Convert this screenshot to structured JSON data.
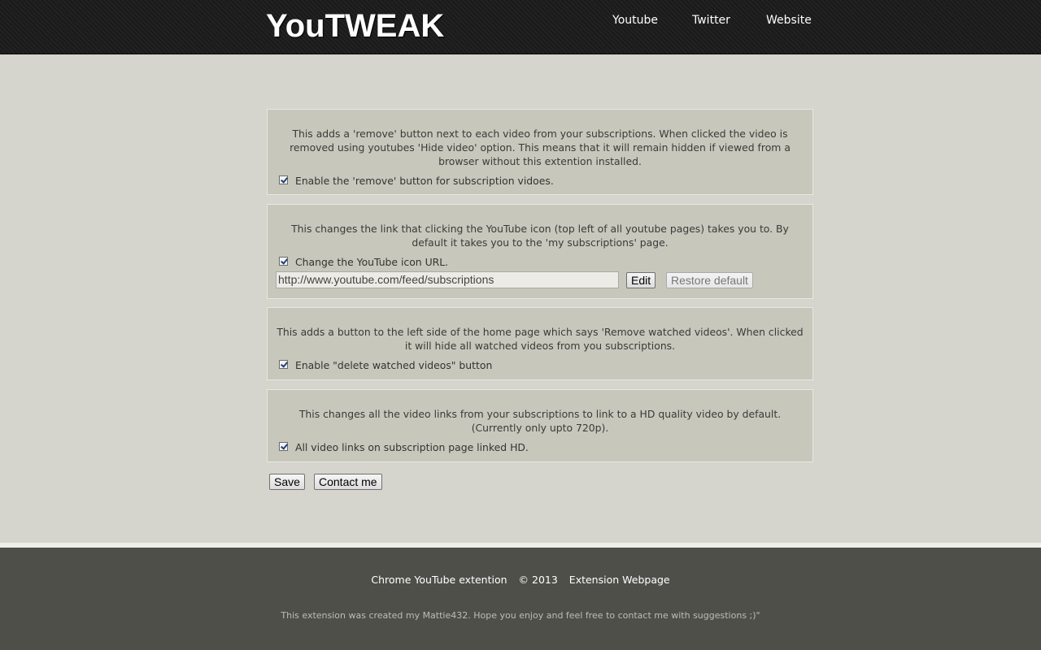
{
  "header": {
    "logo": "YouTWEAK",
    "nav": [
      "Youtube",
      "Twitter",
      "Website"
    ]
  },
  "panels": [
    {
      "description": "This adds a 'remove' button next to each video from your subscriptions. When clicked the video is removed using youtubes 'Hide video' option. This means that it will remain hidden if viewed from a browser without this extention installed.",
      "option_label": "Enable the 'remove' button for subscription vidoes.",
      "checked": true
    },
    {
      "description": "This changes the link that clicking the YouTube icon (top left of all youtube pages) takes you to. By default it takes you to the 'my subscriptions' page.",
      "option_label": "Change the YouTube icon URL.",
      "checked": true,
      "url_value": "http://www.youtube.com/feed/subscriptions",
      "edit_label": "Edit",
      "restore_label": "Restore default"
    },
    {
      "description": "This adds a button to the left side of the home page which says 'Remove watched videos'. When clicked it will hide all watched videos from you subscriptions.",
      "option_label": "Enable \"delete watched videos\" button",
      "checked": true
    },
    {
      "description": "This changes all the video links from your subscriptions to link to a HD quality video by default. (Currently only upto 720p).",
      "option_label": "All video links on subscription page linked HD.",
      "checked": true
    }
  ],
  "actions": {
    "save_label": "Save",
    "contact_label": "Contact me"
  },
  "footer": {
    "link1": "Chrome YouTube extention",
    "copyright": "© 2013",
    "link2": "Extension Webpage",
    "note": "This extension was created my Mattie432. Hope you enjoy and feel free to contact me with suggestions ;)\""
  },
  "colors": {
    "page_bg": "#d6d5cd",
    "panel_bg": "#c8c7bb",
    "header_bg": "#1e1e1e",
    "footer_bg": "#4f4f4a"
  }
}
